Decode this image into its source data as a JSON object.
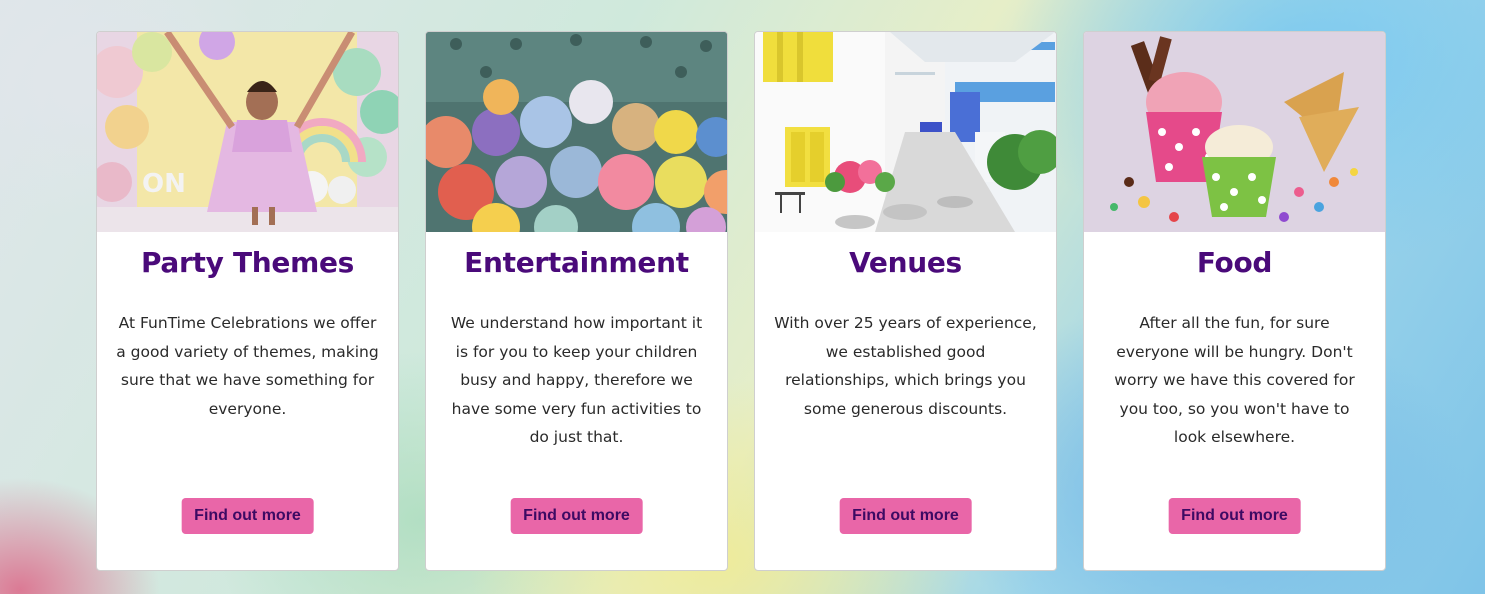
{
  "cards": [
    {
      "title": "Party Themes",
      "text": "At FunTime Celebrations we offer a good variety of themes, making sure that we have something for everyone.",
      "button": "Find out more",
      "image_alt": "Toddler in pink dress with balloon decorations"
    },
    {
      "title": "Entertainment",
      "text": "We understand how important it is for you to keep your children busy and happy, therefore we have some very fun activities to do just that.",
      "button": "Find out more",
      "image_alt": "Colorful ball pit balls"
    },
    {
      "title": "Venues",
      "text": "With over 25 years of experience, we established good relationships, which brings you some generous discounts.",
      "button": "Find out more",
      "image_alt": "Colorful white alley with yellow and blue windows"
    },
    {
      "title": "Food",
      "text": "After all the fun, for sure everyone will be hungry. Don't worry we have this covered for you too, so you won't have to look elsewhere.",
      "button": "Find out more",
      "image_alt": "Ice cream cups with sprinkles and cones"
    }
  ],
  "colors": {
    "title": "#4a0a7a",
    "button_bg": "#e966a8",
    "button_text": "#3d0a63"
  }
}
